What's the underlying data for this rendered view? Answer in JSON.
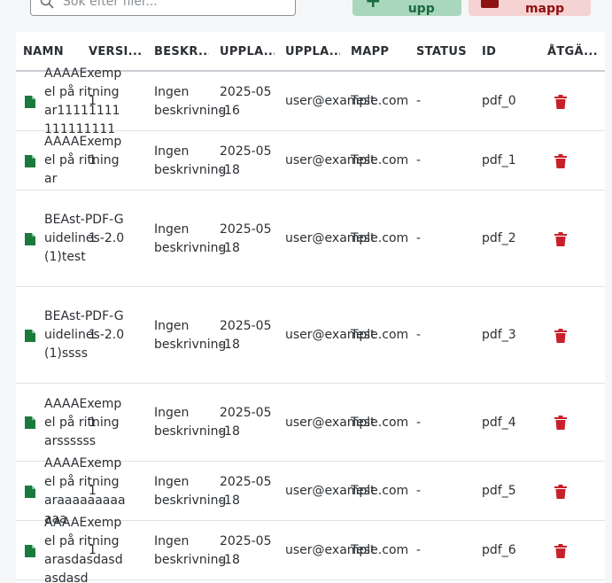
{
  "toolbar": {
    "search_placeholder": "Sök efter filer...",
    "upload_label": "Ladda upp",
    "delete_folder_label": "Ta bort mapp"
  },
  "table": {
    "columns": [
      "NAMN",
      "VERSI...",
      "BESKR...",
      "UPPLA...",
      "UPPLA...",
      "MAPP",
      "STATUS",
      "ID",
      "ÅTGÄ..."
    ],
    "rows": [
      {
        "name": "AAAAExempel på ritningar11111111111111111",
        "version": "1",
        "description": "Ingen beskrivning",
        "date": "2025-05-16",
        "uploader": "user@example.com",
        "folder": "Test",
        "status": "-",
        "id": "pdf_0"
      },
      {
        "name": "AAAAExempel på ritningar",
        "version": "1",
        "description": "Ingen beskrivning",
        "date": "2025-05-18",
        "uploader": "user@example.com",
        "folder": "Test",
        "status": "-",
        "id": "pdf_1"
      },
      {
        "name": "BEAst-PDF-Guidelines-2.0 (1)test",
        "version": "1",
        "description": "Ingen beskrivning",
        "date": "2025-05-18",
        "uploader": "user@example.com",
        "folder": "Test",
        "status": "-",
        "id": "pdf_2"
      },
      {
        "name": "BEAst-PDF-Guidelines-2.0 (1)ssss",
        "version": "1",
        "description": "Ingen beskrivning",
        "date": "2025-05-18",
        "uploader": "user@example.com",
        "folder": "Test",
        "status": "-",
        "id": "pdf_3"
      },
      {
        "name": "AAAAExempel på ritningarssssss",
        "version": "1",
        "description": "Ingen beskrivning",
        "date": "2025-05-18",
        "uploader": "user@example.com",
        "folder": "Test",
        "status": "-",
        "id": "pdf_4"
      },
      {
        "name": "AAAAExempel på ritningaraaaaaaaaaaaa",
        "version": "1",
        "description": "Ingen beskrivning",
        "date": "2025-05-18",
        "uploader": "user@example.com",
        "folder": "Test",
        "status": "-",
        "id": "pdf_5"
      },
      {
        "name": "AAAAExempel på ritningarasdasdasdasdasd",
        "version": "1",
        "description": "Ingen beskrivning",
        "date": "2025-05-18",
        "uploader": "user@example.com",
        "folder": "Test",
        "status": "-",
        "id": "pdf_6"
      }
    ]
  },
  "colors": {
    "file_icon": "#1a7a3c",
    "trash_icon": "#c8202a",
    "upload_button_bg": "#a8d7bd",
    "delete_button_bg": "#f6d3d3"
  }
}
